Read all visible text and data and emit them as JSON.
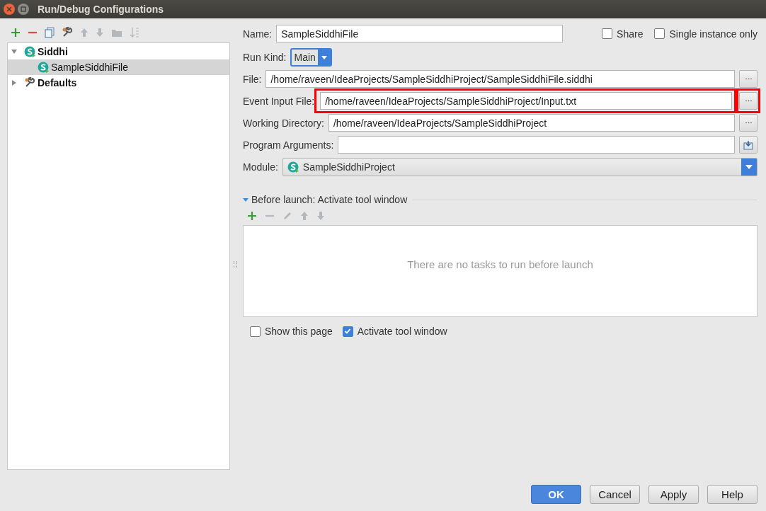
{
  "window": {
    "title": "Run/Debug Configurations"
  },
  "toolbar": [
    {
      "kind": "add",
      "disabled": false
    },
    {
      "kind": "remove",
      "disabled": false
    },
    {
      "kind": "copy",
      "disabled": false
    },
    {
      "kind": "wrench",
      "disabled": false
    },
    {
      "kind": "up",
      "disabled": true
    },
    {
      "kind": "down",
      "disabled": true
    },
    {
      "kind": "folder",
      "disabled": true
    },
    {
      "kind": "sort",
      "disabled": true
    }
  ],
  "tree": [
    {
      "label": "Siddhi",
      "kind": "siddhi",
      "expanded": true,
      "selected": false,
      "children": [
        {
          "label": "SampleSiddhiFile",
          "kind": "siddhi",
          "selected": false,
          "highlighted": true
        }
      ]
    },
    {
      "label": "Defaults",
      "kind": "wrench",
      "expanded": false,
      "selected": false
    }
  ],
  "name": {
    "label": "Name:",
    "value": "SampleSiddhiFile"
  },
  "share": {
    "label": "Share",
    "checked": false
  },
  "single_instance": {
    "label": "Single instance only",
    "checked": false
  },
  "run_kind": {
    "label": "Run Kind:",
    "value": "Main"
  },
  "fields": [
    {
      "label": "File:",
      "value": "/home/raveen/IdeaProjects/SampleSiddhiProject/SampleSiddhiFile.siddhi",
      "kind": "browse",
      "highlighted": false
    },
    {
      "label": "Event Input File:",
      "value": "/home/raveen/IdeaProjects/SampleSiddhiProject/Input.txt",
      "kind": "browse",
      "highlighted": true
    },
    {
      "label": "Working Directory:",
      "value": "/home/raveen/IdeaProjects/SampleSiddhiProject",
      "kind": "browse",
      "highlighted": false
    },
    {
      "label": "Program Arguments:",
      "kind": "expand",
      "highlighted": false
    }
  ],
  "module": {
    "label": "Module:",
    "value": "SampleSiddhiProject"
  },
  "before_launch": {
    "title": "Before launch: Activate tool window",
    "expanded": true,
    "toolbar": [
      {
        "kind": "add",
        "disabled": false
      },
      {
        "kind": "remove",
        "disabled": true
      },
      {
        "kind": "edit",
        "disabled": true
      },
      {
        "kind": "up",
        "disabled": true
      },
      {
        "kind": "down",
        "disabled": true
      }
    ],
    "empty_text": "There are no tasks to run before launch"
  },
  "options": [
    {
      "label": "Show this page",
      "checked": false
    },
    {
      "label": "Activate tool window",
      "checked": true
    }
  ],
  "buttons": [
    {
      "label": "OK",
      "default": true
    },
    {
      "label": "Cancel",
      "default": false
    },
    {
      "label": "Apply",
      "default": false
    },
    {
      "label": "Help",
      "default": false
    }
  ]
}
